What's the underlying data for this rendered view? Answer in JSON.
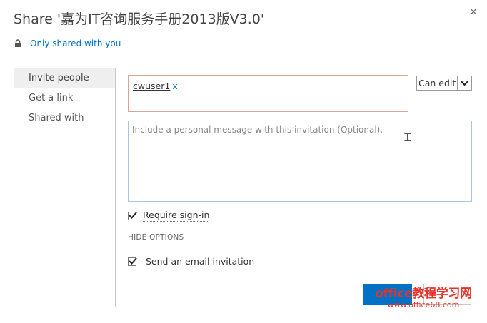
{
  "dialog": {
    "title": "Share '嘉为IT咨询服务手册2013版V3.0'",
    "close_glyph": "×",
    "shared_status": "Only shared with you"
  },
  "nav": {
    "items": [
      {
        "label": "Invite people",
        "active": true
      },
      {
        "label": "Get a link",
        "active": false
      },
      {
        "label": "Shared with",
        "active": false
      }
    ]
  },
  "invite": {
    "people": [
      {
        "name": "cwuser1",
        "remove": "x"
      }
    ],
    "permission": "Can edit",
    "message_placeholder": "Include a personal message with this invitation (Optional).",
    "require_signin": {
      "label": "Require sign-in",
      "checked": true
    },
    "hide_options": "HIDE OPTIONS",
    "send_email": {
      "label": "Send an email invitation",
      "checked": true
    }
  },
  "watermark": {
    "line1": "office教程学习网",
    "line2": "www.office68.com"
  },
  "colors": {
    "accent": "#0072c6",
    "people_border": "#d9a49a",
    "message_border": "#a9c6dd",
    "watermark": "#e5332a"
  }
}
